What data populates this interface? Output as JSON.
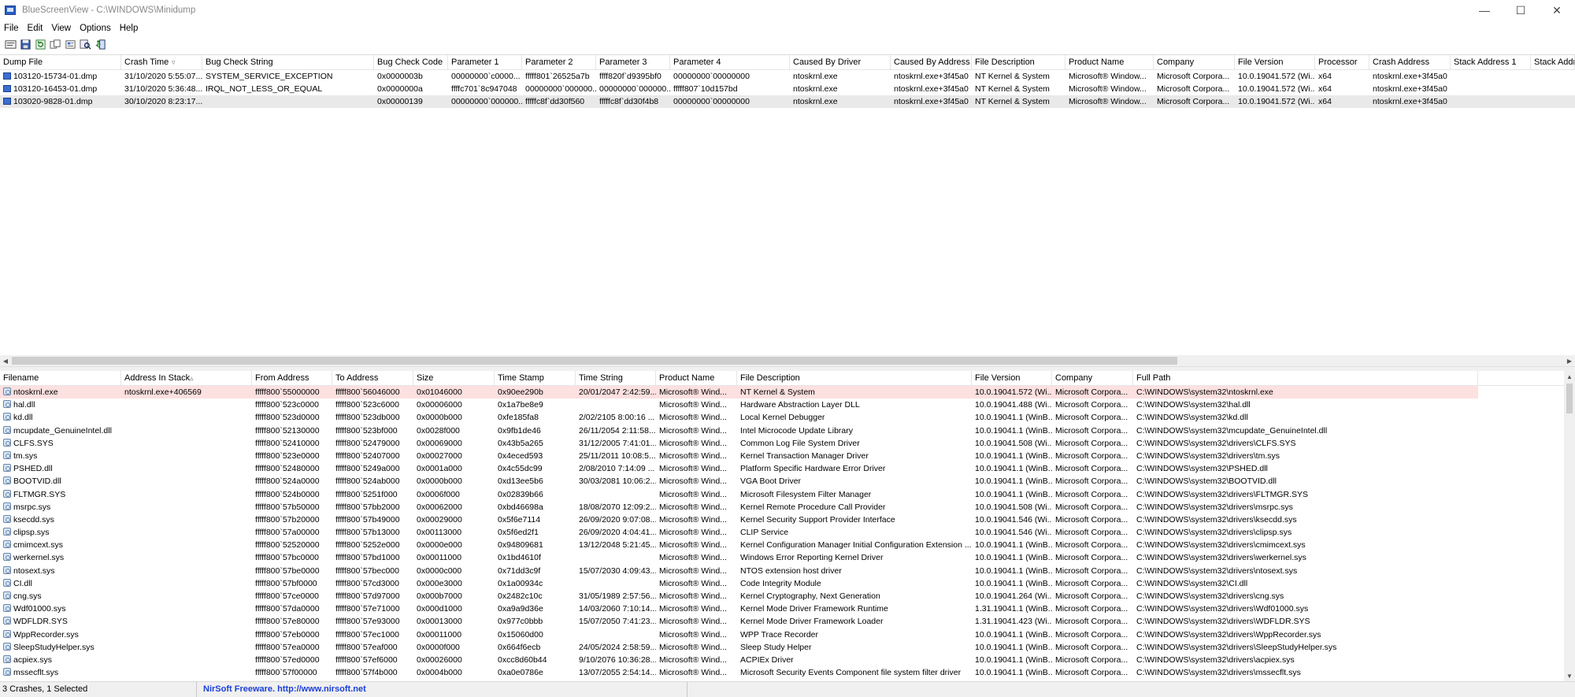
{
  "window": {
    "title": "BlueScreenView  -  C:\\WINDOWS\\Minidump",
    "minimize": "—",
    "maximize": "☐",
    "close": "✕"
  },
  "menu": [
    "File",
    "Edit",
    "View",
    "Options",
    "Help"
  ],
  "toolbar": [
    "properties-icon",
    "save-icon",
    "refresh-icon",
    "copy-icon",
    "html-report-icon",
    "find-icon",
    "exit-icon"
  ],
  "upper": {
    "columns": [
      "Dump File",
      "Crash Time",
      "Bug Check String",
      "Bug Check Code",
      "Parameter 1",
      "Parameter 2",
      "Parameter 3",
      "Parameter 4",
      "Caused By Driver",
      "Caused By Address",
      "File Description",
      "Product Name",
      "Company",
      "File Version",
      "Processor",
      "Crash Address",
      "Stack Address 1",
      "Stack Addre"
    ],
    "rows": [
      [
        "103120-15734-01.dmp",
        "31/10/2020 5:55:07...",
        "SYSTEM_SERVICE_EXCEPTION",
        "0x0000003b",
        "00000000`c0000...",
        "fffff801`26525a7b",
        "ffff820f`d9395bf0",
        "00000000`00000000",
        "ntoskrnl.exe",
        "ntoskrnl.exe+3f45a0",
        "NT Kernel & System",
        "Microsoft® Window...",
        "Microsoft Corpora...",
        "10.0.19041.572 (Wi...",
        "x64",
        "ntoskrnl.exe+3f45a0",
        "",
        ""
      ],
      [
        "103120-16453-01.dmp",
        "31/10/2020 5:36:48...",
        "IRQL_NOT_LESS_OR_EQUAL",
        "0x0000000a",
        "ffffc701`8c947048",
        "00000000`000000...",
        "00000000`000000...",
        "fffff807`10d157bd",
        "ntoskrnl.exe",
        "ntoskrnl.exe+3f45a0",
        "NT Kernel & System",
        "Microsoft® Window...",
        "Microsoft Corpora...",
        "10.0.19041.572 (Wi...",
        "x64",
        "ntoskrnl.exe+3f45a0",
        "",
        ""
      ],
      [
        "103020-9828-01.dmp",
        "30/10/2020 8:23:17...",
        "",
        "0x00000139",
        "00000000`000000...",
        "fffffc8f`dd30f560",
        "fffffc8f`dd30f4b8",
        "00000000`00000000",
        "ntoskrnl.exe",
        "ntoskrnl.exe+3f45a0",
        "NT Kernel & System",
        "Microsoft® Window...",
        "Microsoft Corpora...",
        "10.0.19041.572 (Wi...",
        "x64",
        "ntoskrnl.exe+3f45a0",
        "",
        ""
      ]
    ]
  },
  "lower": {
    "columns": [
      "Filename",
      "Address In Stack",
      "From Address",
      "To Address",
      "Size",
      "Time Stamp",
      "Time String",
      "Product Name",
      "File Description",
      "File Version",
      "Company",
      "Full Path"
    ],
    "rows": [
      [
        "ntoskrnl.exe",
        "ntoskrnl.exe+406569",
        "fffff800`55000000",
        "fffff800`56046000",
        "0x01046000",
        "0x90ee290b",
        "20/01/2047 2:42:59...",
        "Microsoft® Wind...",
        "NT Kernel & System",
        "10.0.19041.572 (Wi...",
        "Microsoft Corpora...",
        "C:\\WINDOWS\\system32\\ntoskrnl.exe"
      ],
      [
        "hal.dll",
        "",
        "fffff800`523c0000",
        "fffff800`523c6000",
        "0x00006000",
        "0x1a7be8e9",
        "",
        "Microsoft® Wind...",
        "Hardware Abstraction Layer DLL",
        "10.0.19041.488 (Wi...",
        "Microsoft Corpora...",
        "C:\\WINDOWS\\system32\\hal.dll"
      ],
      [
        "kd.dll",
        "",
        "fffff800`523d0000",
        "fffff800`523db000",
        "0x0000b000",
        "0xfe185fa8",
        "2/02/2105 8:00:16 ...",
        "Microsoft® Wind...",
        "Local Kernel Debugger",
        "10.0.19041.1 (WinB...",
        "Microsoft Corpora...",
        "C:\\WINDOWS\\system32\\kd.dll"
      ],
      [
        "mcupdate_GenuineIntel.dll",
        "",
        "fffff800`52130000",
        "fffff800`523bf000",
        "0x0028f000",
        "0x9fb1de46",
        "26/11/2054 2:11:58...",
        "Microsoft® Wind...",
        "Intel Microcode Update Library",
        "10.0.19041.1 (WinB...",
        "Microsoft Corpora...",
        "C:\\WINDOWS\\system32\\mcupdate_GenuineIntel.dll"
      ],
      [
        "CLFS.SYS",
        "",
        "fffff800`52410000",
        "fffff800`52479000",
        "0x00069000",
        "0x43b5a265",
        "31/12/2005 7:41:01...",
        "Microsoft® Wind...",
        "Common Log File System Driver",
        "10.0.19041.508 (Wi...",
        "Microsoft Corpora...",
        "C:\\WINDOWS\\system32\\drivers\\CLFS.SYS"
      ],
      [
        "tm.sys",
        "",
        "fffff800`523e0000",
        "fffff800`52407000",
        "0x00027000",
        "0x4eced593",
        "25/11/2011 10:08:5...",
        "Microsoft® Wind...",
        "Kernel Transaction Manager Driver",
        "10.0.19041.1 (WinB...",
        "Microsoft Corpora...",
        "C:\\WINDOWS\\system32\\drivers\\tm.sys"
      ],
      [
        "PSHED.dll",
        "",
        "fffff800`52480000",
        "fffff800`5249a000",
        "0x0001a000",
        "0x4c55dc99",
        "2/08/2010 7:14:09 ...",
        "Microsoft® Wind...",
        "Platform Specific Hardware Error Driver",
        "10.0.19041.1 (WinB...",
        "Microsoft Corpora...",
        "C:\\WINDOWS\\system32\\PSHED.dll"
      ],
      [
        "BOOTVID.dll",
        "",
        "fffff800`524a0000",
        "fffff800`524ab000",
        "0x0000b000",
        "0xd13ee5b6",
        "30/03/2081 10:06:2...",
        "Microsoft® Wind...",
        "VGA Boot Driver",
        "10.0.19041.1 (WinB...",
        "Microsoft Corpora...",
        "C:\\WINDOWS\\system32\\BOOTVID.dll"
      ],
      [
        "FLTMGR.SYS",
        "",
        "fffff800`524b0000",
        "fffff800`5251f000",
        "0x0006f000",
        "0x02839b66",
        "",
        "Microsoft® Wind...",
        "Microsoft Filesystem Filter Manager",
        "10.0.19041.1 (WinB...",
        "Microsoft Corpora...",
        "C:\\WINDOWS\\system32\\drivers\\FLTMGR.SYS"
      ],
      [
        "msrpc.sys",
        "",
        "fffff800`57b50000",
        "fffff800`57bb2000",
        "0x00062000",
        "0xbd46698a",
        "18/08/2070 12:09:2...",
        "Microsoft® Wind...",
        "Kernel Remote Procedure Call Provider",
        "10.0.19041.508 (Wi...",
        "Microsoft Corpora...",
        "C:\\WINDOWS\\system32\\drivers\\msrpc.sys"
      ],
      [
        "ksecdd.sys",
        "",
        "fffff800`57b20000",
        "fffff800`57b49000",
        "0x00029000",
        "0x5f6e7114",
        "26/09/2020 9:07:08...",
        "Microsoft® Wind...",
        "Kernel Security Support Provider Interface",
        "10.0.19041.546 (Wi...",
        "Microsoft Corpora...",
        "C:\\WINDOWS\\system32\\drivers\\ksecdd.sys"
      ],
      [
        "clipsp.sys",
        "",
        "fffff800`57a00000",
        "fffff800`57b13000",
        "0x00113000",
        "0x5f6ed2f1",
        "26/09/2020 4:04:41...",
        "Microsoft® Wind...",
        "CLIP Service",
        "10.0.19041.546 (Wi...",
        "Microsoft Corpora...",
        "C:\\WINDOWS\\system32\\drivers\\clipsp.sys"
      ],
      [
        "cmimcext.sys",
        "",
        "fffff800`52520000",
        "fffff800`5252e000",
        "0x0000e000",
        "0x94809681",
        "13/12/2048 5:21:45...",
        "Microsoft® Wind...",
        "Kernel Configuration Manager Initial Configuration Extension ...",
        "10.0.19041.1 (WinB...",
        "Microsoft Corpora...",
        "C:\\WINDOWS\\system32\\drivers\\cmimcext.sys"
      ],
      [
        "werkernel.sys",
        "",
        "fffff800`57bc0000",
        "fffff800`57bd1000",
        "0x00011000",
        "0x1bd4610f",
        "",
        "Microsoft® Wind...",
        "Windows Error Reporting Kernel Driver",
        "10.0.19041.1 (WinB...",
        "Microsoft Corpora...",
        "C:\\WINDOWS\\system32\\drivers\\werkernel.sys"
      ],
      [
        "ntosext.sys",
        "",
        "fffff800`57be0000",
        "fffff800`57bec000",
        "0x0000c000",
        "0x71dd3c9f",
        "15/07/2030 4:09:43...",
        "Microsoft® Wind...",
        "NTOS extension host driver",
        "10.0.19041.1 (WinB...",
        "Microsoft Corpora...",
        "C:\\WINDOWS\\system32\\drivers\\ntosext.sys"
      ],
      [
        "CI.dll",
        "",
        "fffff800`57bf0000",
        "fffff800`57cd3000",
        "0x000e3000",
        "0x1a00934c",
        "",
        "Microsoft® Wind...",
        "Code Integrity Module",
        "10.0.19041.1 (WinB...",
        "Microsoft Corpora...",
        "C:\\WINDOWS\\system32\\CI.dll"
      ],
      [
        "cng.sys",
        "",
        "fffff800`57ce0000",
        "fffff800`57d97000",
        "0x000b7000",
        "0x2482c10c",
        "31/05/1989 2:57:56...",
        "Microsoft® Wind...",
        "Kernel Cryptography, Next Generation",
        "10.0.19041.264 (Wi...",
        "Microsoft Corpora...",
        "C:\\WINDOWS\\system32\\drivers\\cng.sys"
      ],
      [
        "Wdf01000.sys",
        "",
        "fffff800`57da0000",
        "fffff800`57e71000",
        "0x000d1000",
        "0xa9a9d36e",
        "14/03/2060 7:10:14...",
        "Microsoft® Wind...",
        "Kernel Mode Driver Framework Runtime",
        "1.31.19041.1 (WinB...",
        "Microsoft Corpora...",
        "C:\\WINDOWS\\system32\\drivers\\Wdf01000.sys"
      ],
      [
        "WDFLDR.SYS",
        "",
        "fffff800`57e80000",
        "fffff800`57e93000",
        "0x00013000",
        "0x977c0bbb",
        "15/07/2050 7:41:23...",
        "Microsoft® Wind...",
        "Kernel Mode Driver Framework Loader",
        "1.31.19041.423 (Wi...",
        "Microsoft Corpora...",
        "C:\\WINDOWS\\system32\\drivers\\WDFLDR.SYS"
      ],
      [
        "WppRecorder.sys",
        "",
        "fffff800`57eb0000",
        "fffff800`57ec1000",
        "0x00011000",
        "0x15060d00",
        "",
        "Microsoft® Wind...",
        "WPP Trace Recorder",
        "10.0.19041.1 (WinB...",
        "Microsoft Corpora...",
        "C:\\WINDOWS\\system32\\drivers\\WppRecorder.sys"
      ],
      [
        "SleepStudyHelper.sys",
        "",
        "fffff800`57ea0000",
        "fffff800`57eaf000",
        "0x0000f000",
        "0x664f6ecb",
        "24/05/2024 2:58:59...",
        "Microsoft® Wind...",
        "Sleep Study Helper",
        "10.0.19041.1 (WinB...",
        "Microsoft Corpora...",
        "C:\\WINDOWS\\system32\\drivers\\SleepStudyHelper.sys"
      ],
      [
        "acpiex.sys",
        "",
        "fffff800`57ed0000",
        "fffff800`57ef6000",
        "0x00026000",
        "0xcc8d60b44",
        "9/10/2076 10:36:28...",
        "Microsoft® Wind...",
        "ACPIEx Driver",
        "10.0.19041.1 (WinB...",
        "Microsoft Corpora...",
        "C:\\WINDOWS\\system32\\drivers\\acpiex.sys"
      ],
      [
        "mssecflt.sys",
        "",
        "fffff800`57f00000",
        "fffff800`57f4b000",
        "0x0004b000",
        "0xa0e0786e",
        "13/07/2055 2:54:14...",
        "Microsoft® Wind...",
        "Microsoft Security Events Component file system filter driver",
        "10.0.19041.1 (WinB...",
        "Microsoft Corpora...",
        "C:\\WINDOWS\\system32\\drivers\\mssecflt.sys"
      ]
    ]
  },
  "status": {
    "count": "3 Crashes, 1 Selected",
    "link": "NirSoft Freeware.  http://www.nirsoft.net"
  }
}
